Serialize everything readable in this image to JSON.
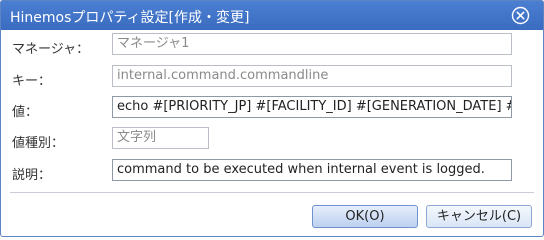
{
  "dialog": {
    "title": "Hinemosプロパティ設定[作成・変更]",
    "close_icon": "close-circle-icon"
  },
  "form": {
    "manager": {
      "label": "マネージャ：",
      "value": "マネージャ1"
    },
    "key": {
      "label": "キー：",
      "value": "internal.command.commandline"
    },
    "value": {
      "label": "値：",
      "value": "echo #[PRIORITY_JP] #[FACILITY_ID] #[GENERATION_DATE] #["
    },
    "value_type": {
      "label": "値種別：",
      "value": "文字列"
    },
    "description": {
      "label": "説明：",
      "value": "command to be executed when internal event is logged."
    }
  },
  "buttons": {
    "ok": "OK(O)",
    "cancel": "キャンセル(C)"
  },
  "colors": {
    "titlebar": "#3f73c8",
    "border": "#5d84c4"
  }
}
